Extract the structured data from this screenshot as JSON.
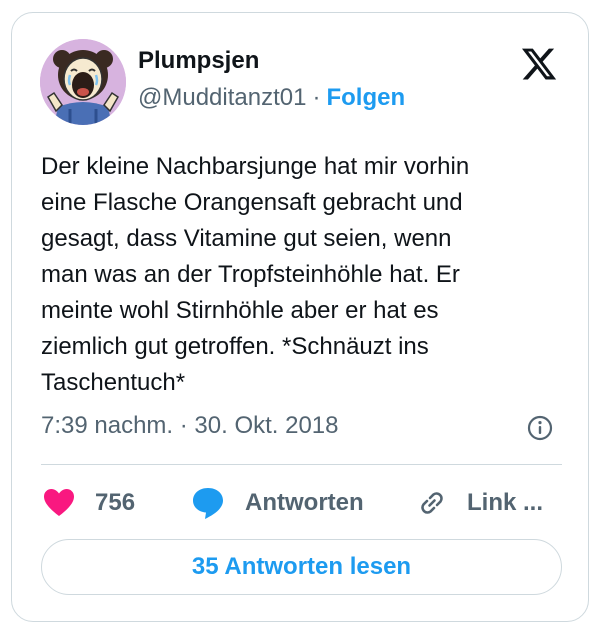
{
  "author": {
    "display_name": "Plumpsjen",
    "handle": "@Mudditanzt01",
    "separator": "·",
    "follow_label": "Folgen",
    "avatar_icon": "cartoon-girl-avatar"
  },
  "platform": {
    "logo_icon": "x-logo-icon"
  },
  "tweet": {
    "text": "Der kleine Nachbarsjunge hat mir vorhin\neine Flasche Orangensaft gebracht und\ngesagt, dass Vitamine gut seien, wenn\nman was an der Tropfsteinhöhle hat. Er\nmeinte wohl Stirnhöhle aber er hat es\nziemlich gut getroffen. *Schnäuzt ins\nTaschentuch*",
    "timestamp": "7:39 nachm. · 30. Okt. 2018",
    "info_icon": "info-icon"
  },
  "actions": {
    "like_count": "756",
    "like_icon": "heart-icon",
    "like_color": "#f91880",
    "reply_label": "Antworten",
    "reply_icon": "speech-bubble-icon",
    "reply_color": "#1d9bf0",
    "link_label": "Link ...",
    "link_icon": "link-icon"
  },
  "footer": {
    "read_replies_label": "35 Antworten lesen"
  },
  "colors": {
    "accent": "#1d9bf0",
    "text": "#0f1419",
    "secondary": "#536471",
    "border": "#cfd9de"
  }
}
